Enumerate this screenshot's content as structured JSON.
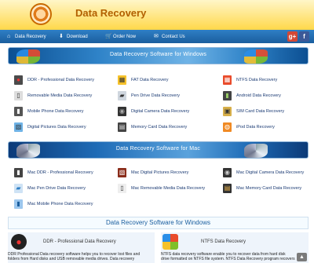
{
  "header": {
    "brand": "Data Recovery"
  },
  "nav": {
    "items": [
      {
        "label": "Data Recovery",
        "icon": "home-icon"
      },
      {
        "label": "Download",
        "icon": "download-icon"
      },
      {
        "label": "Order Now",
        "icon": "cart-icon"
      },
      {
        "label": "Contact Us",
        "icon": "mail-icon"
      }
    ],
    "social": {
      "gplus": "g+",
      "facebook": "f"
    }
  },
  "windows_banner": {
    "title": "Data Recovery Software for Windows"
  },
  "windows_items": [
    {
      "label": "DDR - Professional Data Recovery",
      "icon": "ddr-pro-icon"
    },
    {
      "label": "FAT Data Recovery",
      "icon": "fat-icon"
    },
    {
      "label": "NTFS Data Recovery",
      "icon": "ntfs-icon"
    },
    {
      "label": "Removable Media Data Recovery",
      "icon": "removable-media-icon"
    },
    {
      "label": "Pen Drive Data Recovery",
      "icon": "pen-drive-icon"
    },
    {
      "label": "Android Data Recovery",
      "icon": "android-icon"
    },
    {
      "label": "Mobile Phone Data Recovery",
      "icon": "mobile-phone-icon"
    },
    {
      "label": "Digital Camera Data Recovery",
      "icon": "digital-camera-icon"
    },
    {
      "label": "SIM Card Data Recovery",
      "icon": "sim-card-icon"
    },
    {
      "label": "Digital Pictures Data Recovery",
      "icon": "digital-pictures-icon"
    },
    {
      "label": "Memory Card Data Recovery",
      "icon": "memory-card-icon"
    },
    {
      "label": "iPod Data Recovery",
      "icon": "ipod-icon"
    }
  ],
  "mac_banner": {
    "title": "Data Recovery Software for Mac"
  },
  "mac_items": [
    {
      "label": "Mac DDR - Professional Recovery",
      "icon": "mac-ddr-icon"
    },
    {
      "label": "Mac Digital Pictures Recovery",
      "icon": "mac-pictures-icon"
    },
    {
      "label": "Mac Digital Camera Data Recovery",
      "icon": "mac-camera-icon"
    },
    {
      "label": "Mac Pen Drive Data Recovery",
      "icon": "mac-pen-drive-icon"
    },
    {
      "label": "Mac Removable Media Data Recovery",
      "icon": "mac-removable-icon"
    },
    {
      "label": "Mac Memory Card Data Recovery",
      "icon": "mac-memory-card-icon"
    },
    {
      "label": "Mac Mobile Phone Data Recovery",
      "icon": "mac-mobile-icon"
    }
  ],
  "windows_section": {
    "title": "Data Recovery Software for Windows",
    "cards": [
      {
        "title": "DDR - Professional Data Recovery",
        "icon": "ddr-pro-icon",
        "desc1": "DDR Professional Data recovery software helps you to recover lost files and",
        "desc2": "folders from Hard disks and USB removable media drives. Data recovery"
      },
      {
        "title": "NTFS Data Recovery",
        "icon": "windows-logo-icon",
        "desc1": "NTFS data recovery software enable you to recover data from hard disk",
        "desc2": "drive formatted on NTFS file system. NTFS Data Recovery program recovers"
      }
    ]
  }
}
